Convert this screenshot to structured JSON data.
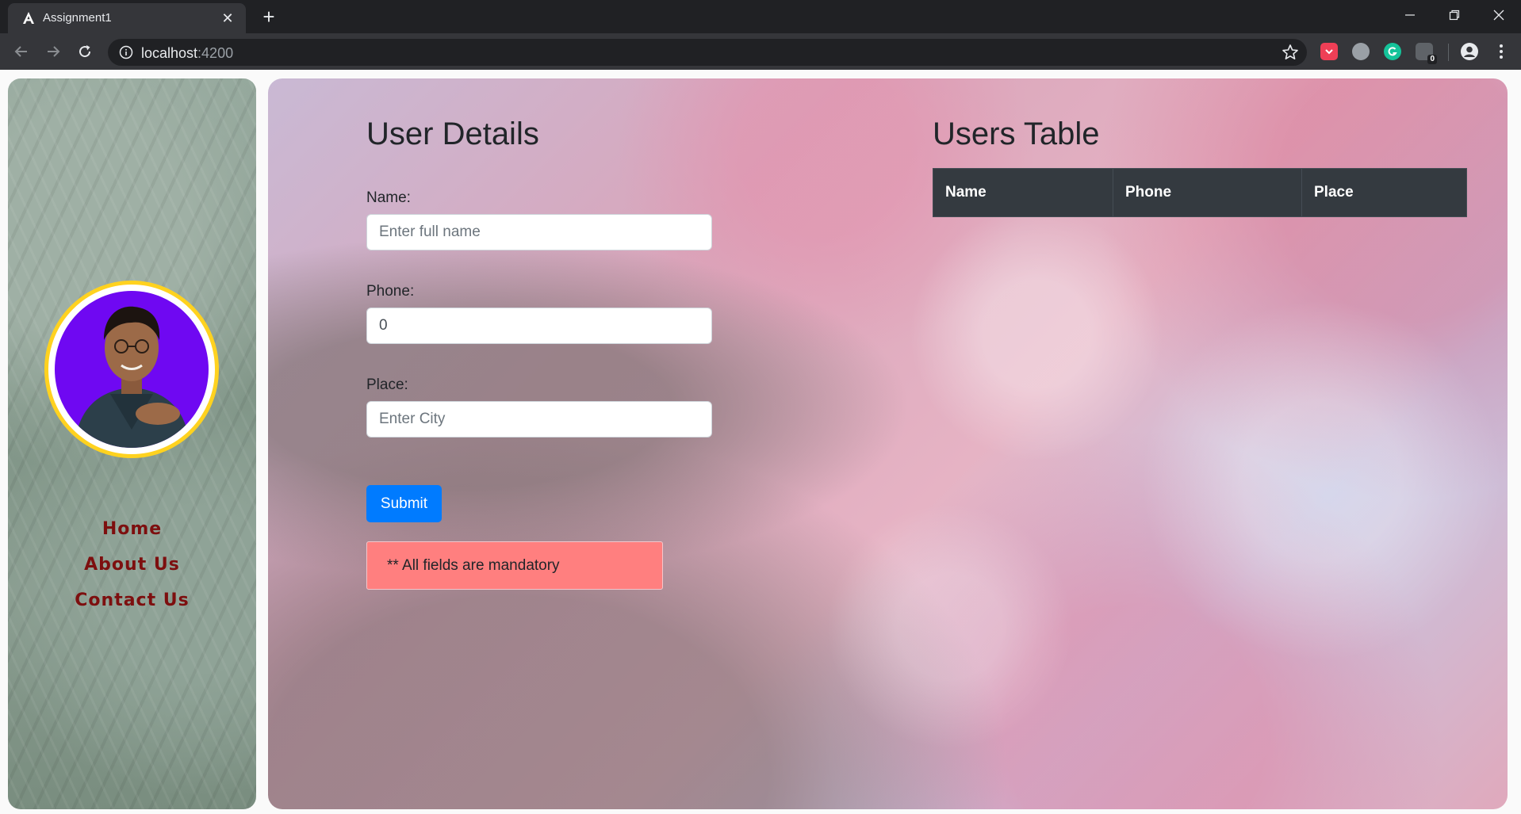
{
  "browser": {
    "tab_title": "Assignment1",
    "tab_close": "✕",
    "new_tab": "+",
    "url_host": "localhost",
    "url_port": ":4200",
    "extension_badge": "0",
    "window_controls": {
      "minimize": "—",
      "restore": "❐",
      "close": "✕"
    }
  },
  "sidebar": {
    "nav": [
      {
        "label": "Home"
      },
      {
        "label": "About Us"
      },
      {
        "label": "Contact Us"
      }
    ],
    "ring_color": "#ffd21f",
    "avatar_bg": "#6f08f2",
    "link_color": "#7d0f0f"
  },
  "form": {
    "title": "User Details",
    "name_label": "Name:",
    "name_placeholder": "Enter full name",
    "name_value": "",
    "phone_label": "Phone:",
    "phone_value": "0",
    "place_label": "Place:",
    "place_placeholder": "Enter City",
    "place_value": "",
    "submit_label": "Submit",
    "alert_text": "** All fields are mandatory"
  },
  "table": {
    "title": "Users Table",
    "columns": [
      "Name",
      "Phone",
      "Place"
    ],
    "rows": []
  },
  "colors": {
    "primary": "#007bff",
    "table_header": "#343a40",
    "alert_bg": "#ff7f7f"
  }
}
